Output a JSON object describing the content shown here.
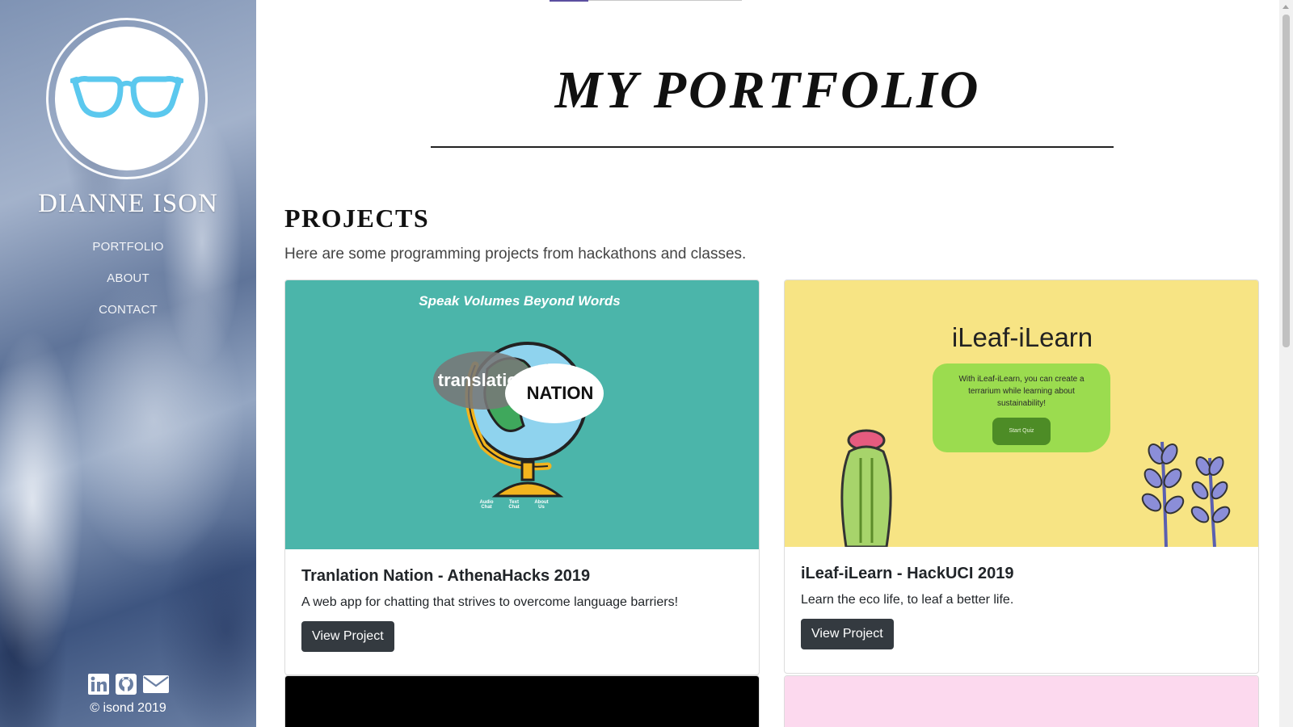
{
  "sidebar": {
    "name": "DIANNE ISON",
    "nav": [
      "PORTFOLIO",
      "ABOUT",
      "CONTACT"
    ],
    "social": [
      "linkedin-icon",
      "github-icon",
      "mail-icon"
    ],
    "copyright": "© isond 2019"
  },
  "main": {
    "title": "MY PORTFOLIO",
    "section_heading": "PROJECTS",
    "section_intro": "Here are some programming projects from hackathons and classes.",
    "projects": [
      {
        "title": "Tranlation Nation - AthenaHacks 2019",
        "description": "A web app for chatting that strives to overcome language barriers!",
        "button": "View Project",
        "image": {
          "bg": "#4bb5aa",
          "tagline": "Speak Volumes Beyond Words",
          "bubble_left": "translation",
          "bubble_right": "NATION",
          "links": [
            "Audio Chat",
            "Text Chat",
            "About Us"
          ]
        }
      },
      {
        "title": "iLeaf-iLearn - HackUCI 2019",
        "description": "Learn the eco life, to leaf a better life.",
        "button": "View Project",
        "image": {
          "bg": "#f7e484",
          "heading": "iLeaf-iLearn",
          "body": "With iLeaf-iLearn, you can create a terrarium while learning about sustainability!",
          "button": "Start Quiz"
        }
      }
    ],
    "next_cards": [
      {
        "bg": "#000000"
      },
      {
        "bg": "#fcd9ee"
      }
    ]
  },
  "colors": {
    "button": "#343a40",
    "glasses": "#5bc8ee",
    "accent_tab": "#5b4fa0"
  }
}
